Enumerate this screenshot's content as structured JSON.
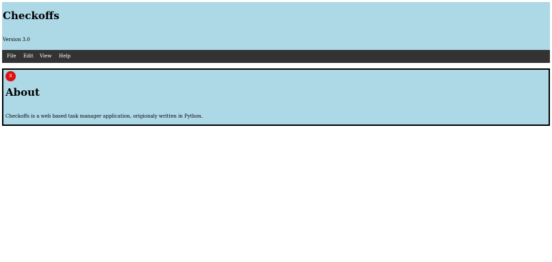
{
  "header": {
    "title": "Checkoffs",
    "version": "Version 3.0",
    "background_color": "#add8e6"
  },
  "menubar": {
    "background_color": "#333333",
    "items": [
      {
        "label": "File"
      },
      {
        "label": "Edit"
      },
      {
        "label": "View"
      },
      {
        "label": "Help"
      }
    ]
  },
  "about_dialog": {
    "close_label": "X",
    "close_color": "#dd1111",
    "title": "About",
    "description": "Checkoffs is a web based task manager application, origionaly written in Python."
  }
}
